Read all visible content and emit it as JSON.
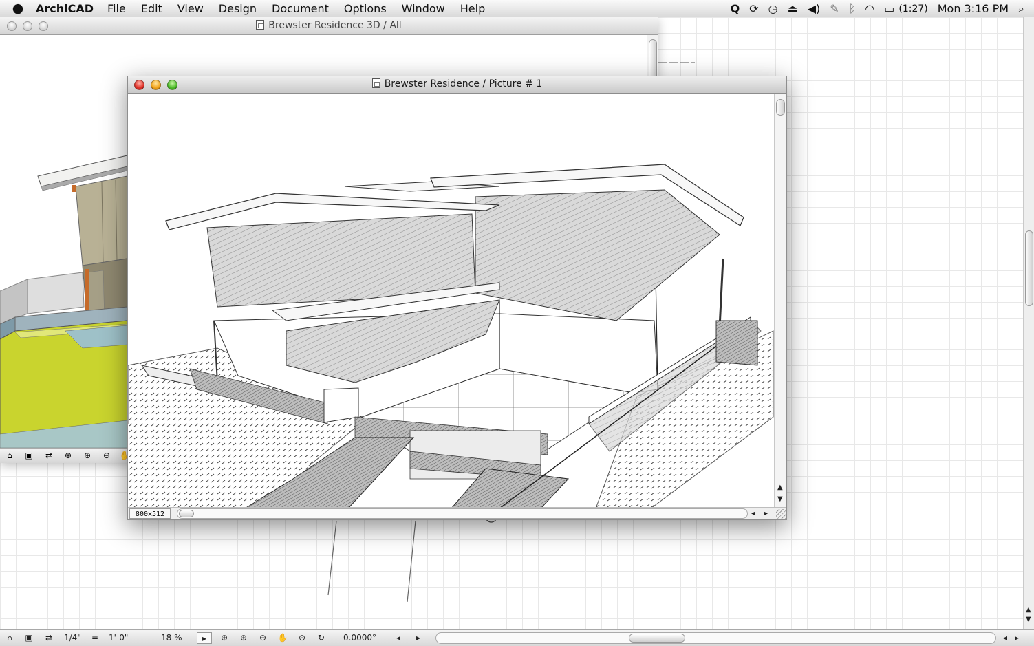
{
  "menubar": {
    "app_name": "ArchiCAD",
    "menus": [
      "File",
      "Edit",
      "View",
      "Design",
      "Document",
      "Options",
      "Window",
      "Help"
    ],
    "battery": "(1:27)",
    "clock": "Mon 3:16 PM"
  },
  "window_3d": {
    "title": "Brewster Residence 3D / All",
    "accent_colors": {
      "lawn": "#c9d42e",
      "wall": "#b8b195",
      "wall_shadow": "#8a846d"
    }
  },
  "picture_window": {
    "title": "Brewster Residence / Picture # 1",
    "size_label": "800x512"
  },
  "plan_toolbar": {
    "scale_left": "1/4\"",
    "scale_eq": "=",
    "scale_right": "1'-0\"",
    "zoom": "18 %",
    "angle": "0.0000°"
  },
  "icons": [
    "apple-icon",
    "spotlight-q-icon",
    "sync-icon",
    "time-machine-icon",
    "eject-icon",
    "volume-icon",
    "pen-icon",
    "bluetooth-icon",
    "wifi-icon",
    "battery-icon",
    "search-icon"
  ]
}
